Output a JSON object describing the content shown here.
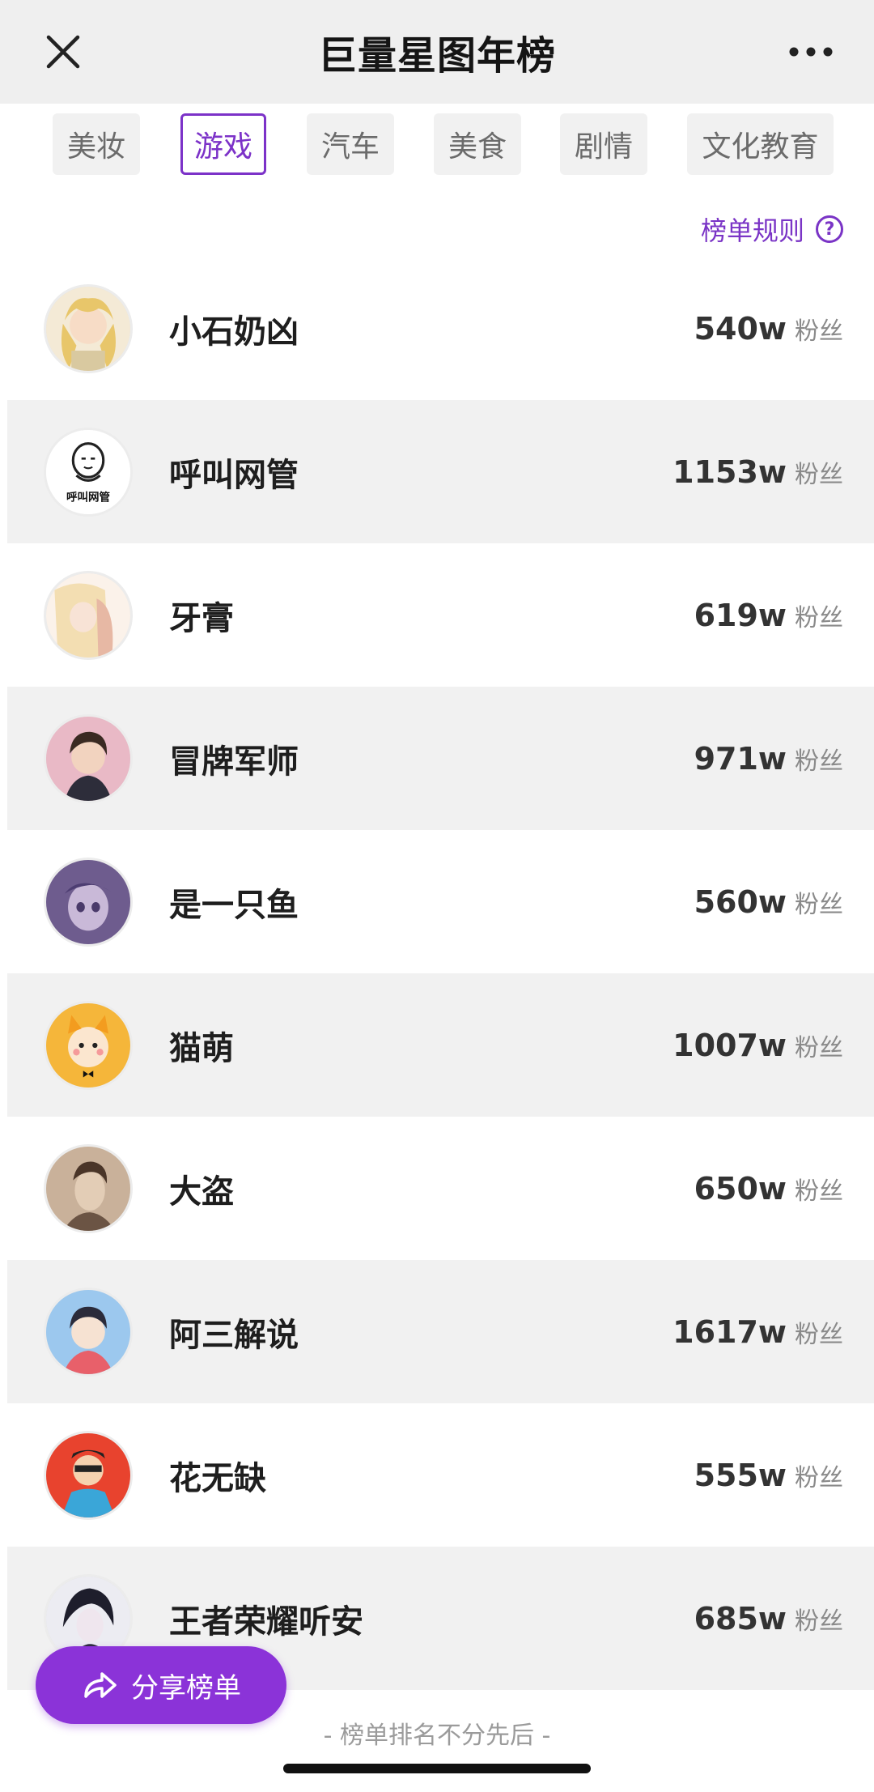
{
  "header": {
    "title": "巨量星图年榜"
  },
  "tabs": [
    {
      "label": "美妆",
      "active": false
    },
    {
      "label": "游戏",
      "active": true
    },
    {
      "label": "汽车",
      "active": false
    },
    {
      "label": "美食",
      "active": false
    },
    {
      "label": "剧情",
      "active": false
    },
    {
      "label": "文化教育",
      "active": false
    }
  ],
  "rules": {
    "label": "榜单规则",
    "icon": "question-icon"
  },
  "ranking": [
    {
      "name": "小石奶凶",
      "fans": "540w",
      "unit": "粉丝"
    },
    {
      "name": "呼叫网管",
      "fans": "1153w",
      "unit": "粉丝",
      "avatar_text": "呼叫网管"
    },
    {
      "name": "牙膏",
      "fans": "619w",
      "unit": "粉丝"
    },
    {
      "name": "冒牌军师",
      "fans": "971w",
      "unit": "粉丝"
    },
    {
      "name": "是一只鱼",
      "fans": "560w",
      "unit": "粉丝"
    },
    {
      "name": "猫萌",
      "fans": "1007w",
      "unit": "粉丝"
    },
    {
      "name": "大盗",
      "fans": "650w",
      "unit": "粉丝"
    },
    {
      "name": "阿三解说",
      "fans": "1617w",
      "unit": "粉丝"
    },
    {
      "name": "花无缺",
      "fans": "555w",
      "unit": "粉丝"
    },
    {
      "name": "王者荣耀听安",
      "fans": "685w",
      "unit": "粉丝"
    }
  ],
  "share": {
    "label": "分享榜单"
  },
  "footer": {
    "note": "- 榜单排名不分先后 -"
  },
  "colors": {
    "accent": "#8b33d8",
    "header_bg": "#efefef",
    "alt_row": "#f1f1f1"
  }
}
